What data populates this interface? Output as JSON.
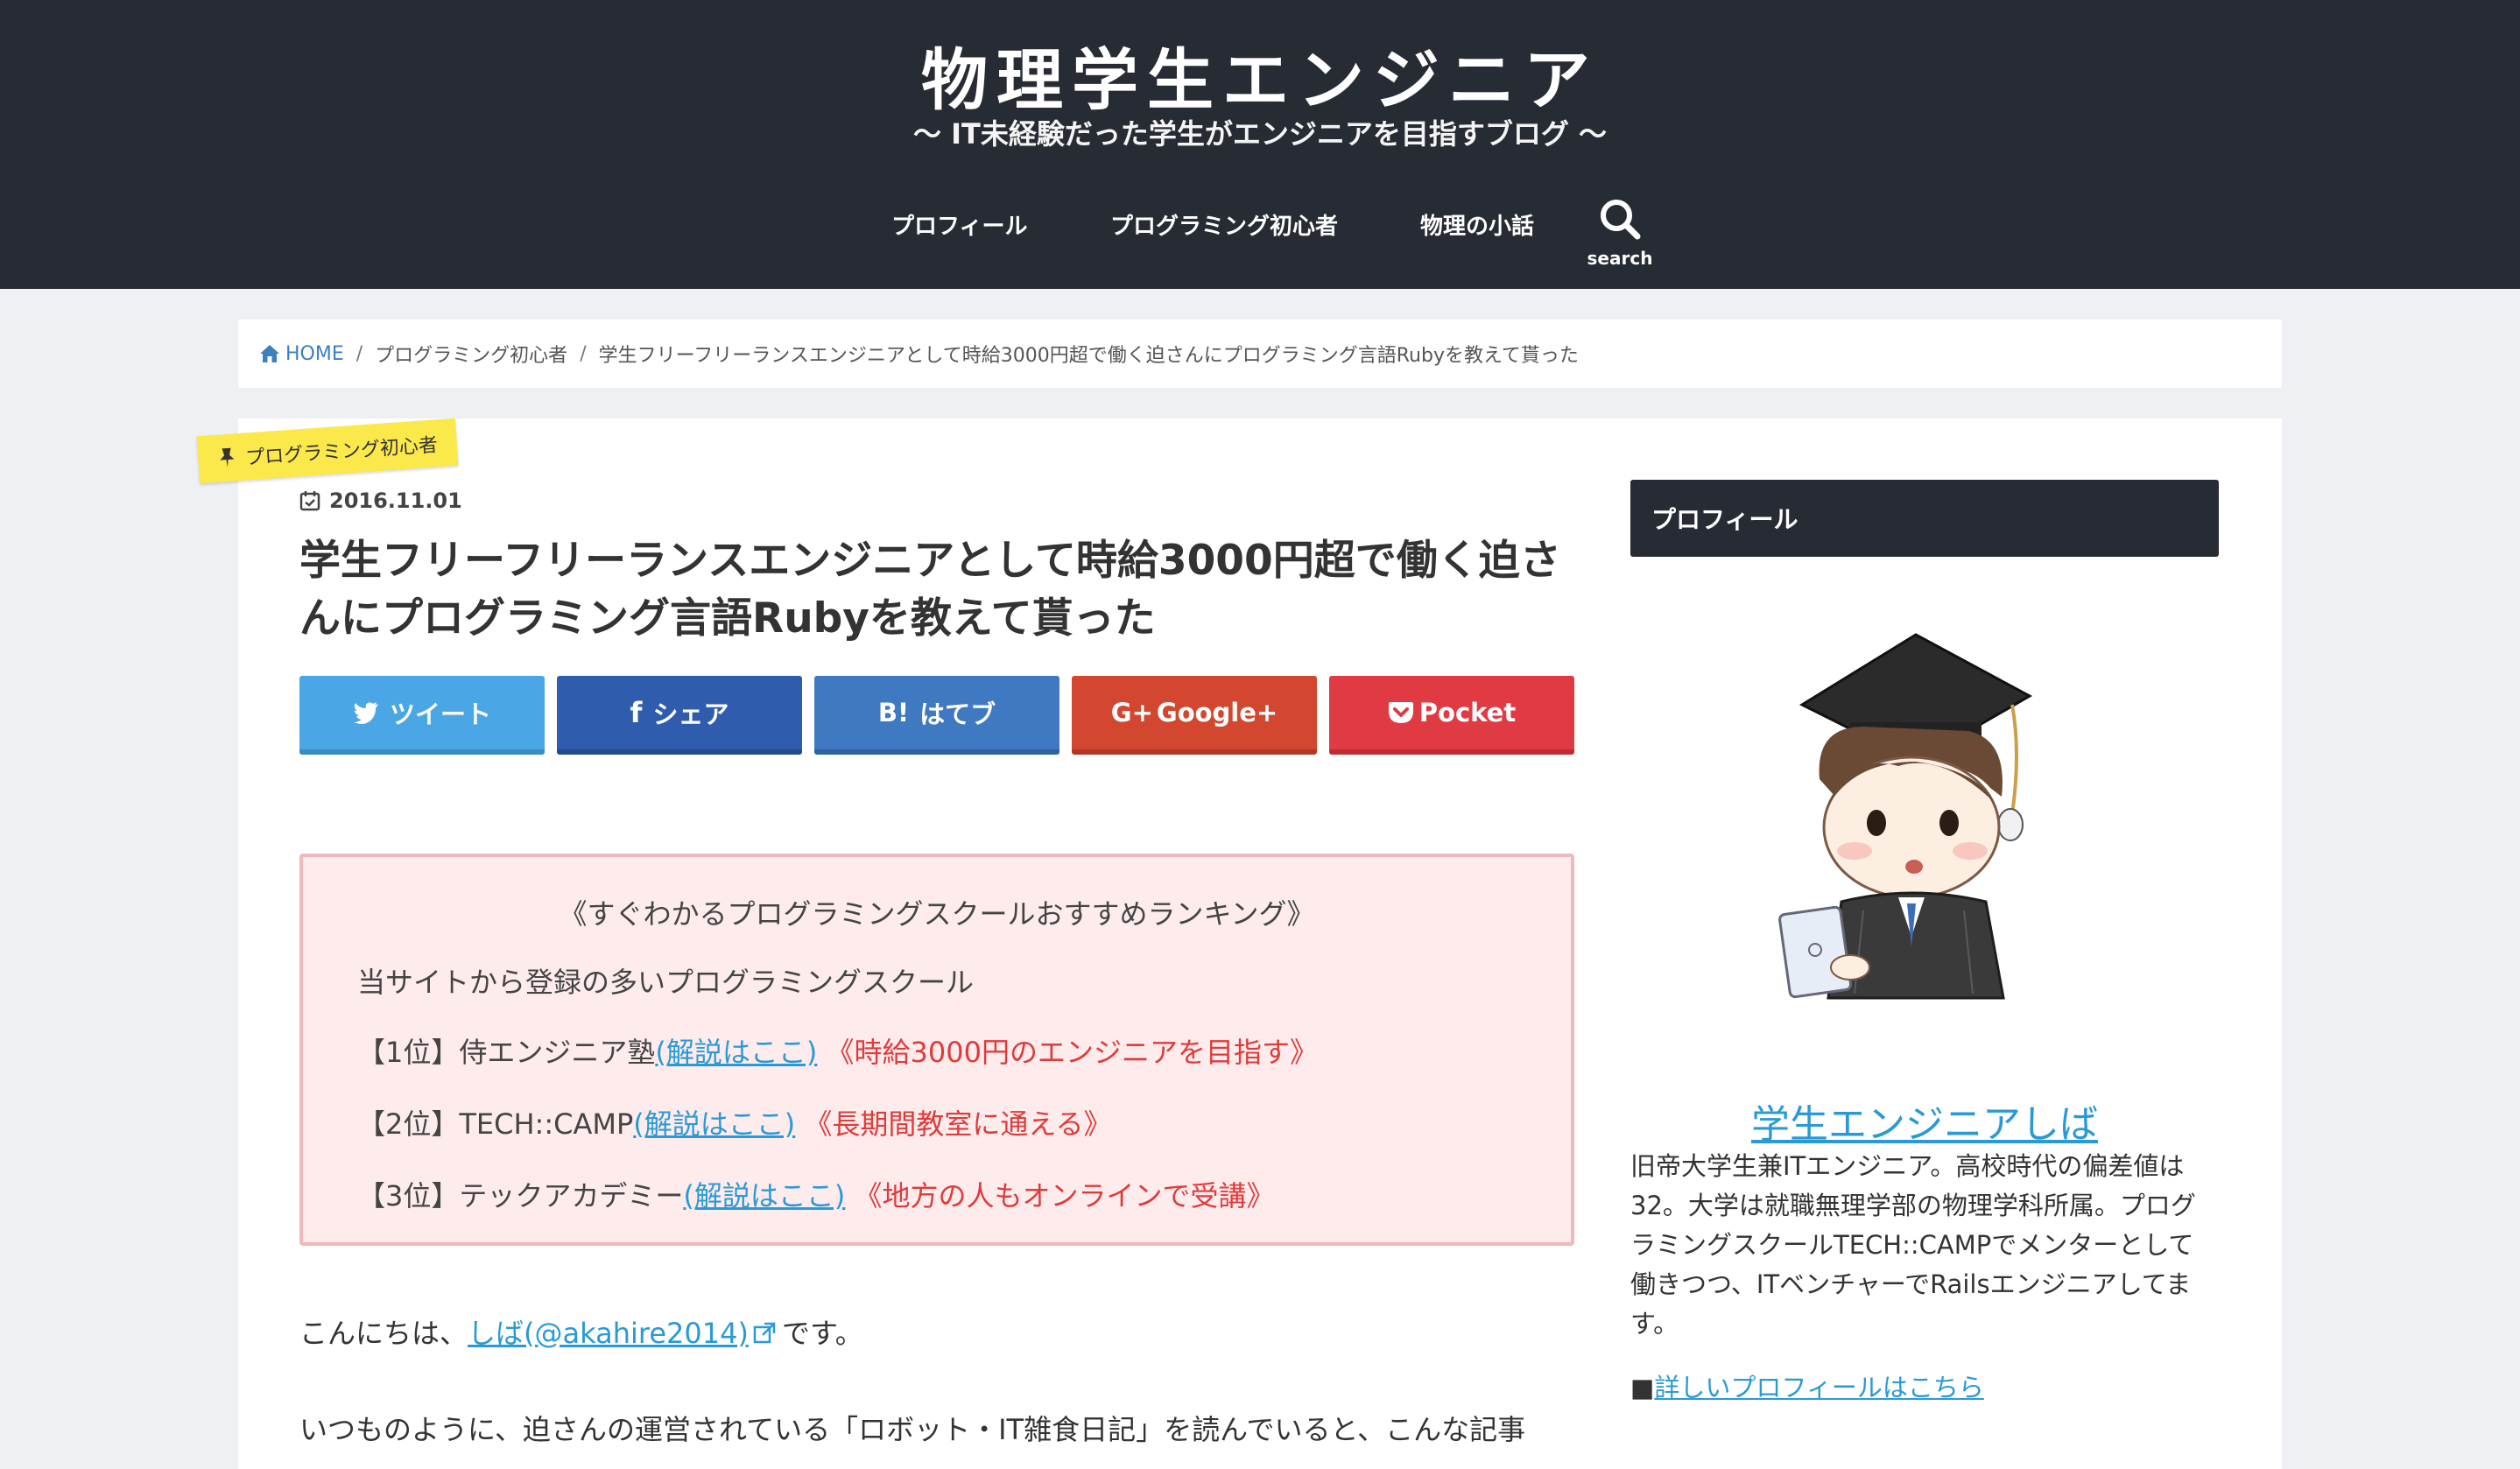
{
  "header": {
    "site_title": "物理学生エンジニア",
    "tagline": "～ IT未経験だった学生がエンジニアを目指すブログ ～",
    "nav": [
      "プロフィール",
      "プログラミング初心者",
      "物理の小話"
    ],
    "search_label": "search"
  },
  "breadcrumb": {
    "home": "HOME",
    "category": "プログラミング初心者",
    "current": "学生フリーフリーランスエンジニアとして時給3000円超で働く迫さんにプログラミング言語Rubyを教えて貰った"
  },
  "article": {
    "category_tag": "プログラミング初心者",
    "date": "2016.11.01",
    "title": "学生フリーフリーランスエンジニアとして時給3000円超で働く迫さんにプログラミング言語Rubyを教えて貰った",
    "share_buttons": [
      {
        "label": "ツイート",
        "icon": "twitter-icon",
        "color": "#4aa6e4"
      },
      {
        "label": "シェア",
        "icon": "facebook-icon",
        "color": "#305cad"
      },
      {
        "label": "はてブ",
        "icon_text": "B!",
        "icon": "hatena-icon",
        "color": "#3e79c1"
      },
      {
        "label": "Google+",
        "icon_text": "G+",
        "icon": "google-plus-icon",
        "color": "#d3462f"
      },
      {
        "label": "Pocket",
        "icon": "pocket-icon",
        "color": "#e03a42"
      }
    ],
    "ranking_box": {
      "heading": "《すぐわかるプログラミングスクールおすすめランキング》",
      "intro": "当サイトから登録の多いプログラミングスクール",
      "items": [
        {
          "rank": "【1位】侍エンジニア塾",
          "link": "(解説はここ)",
          "note": "《時給3000円のエンジニアを目指す》"
        },
        {
          "rank": "【2位】TECH::CAMP",
          "link": "(解説はここ)",
          "note": "《長期間教室に通える》"
        },
        {
          "rank": "【3位】テックアカデミー",
          "link": "(解説はここ)",
          "note": "《地方の人もオンラインで受講》"
        }
      ]
    },
    "greeting_before": "こんにちは、",
    "greeting_link": "しば(@akahire2014)",
    "greeting_after": "です。",
    "paragraph2": "いつものように、迫さんの運営されている「ロボット・IT雑食日記」を読んでいると、こんな記事"
  },
  "sidebar": {
    "heading": "プロフィール",
    "name": "学生エンジニアしば",
    "description": "旧帝大学生兼ITエンジニア。高校時代の偏差値は32。大学は就職無理学部の物理学科所属。プログラミングスクールTECH::CAMPでメンターとして働きつつ、ITベンチャーでRailsエンジニアしてます。",
    "more_prefix": "■",
    "more_link": "詳しいプロフィールはこちら"
  }
}
